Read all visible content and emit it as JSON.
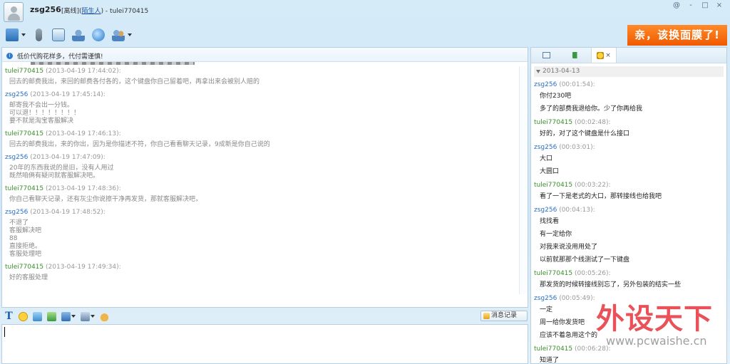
{
  "title": {
    "nickname": "zsg256",
    "status_prefix": "[离线](",
    "status_link": "陌生人",
    "status_suffix": ") - tulei770415"
  },
  "window_buttons": [
    "@",
    "-",
    "□",
    "×"
  ],
  "promo": {
    "text": "亲，该换面膜了!"
  },
  "notice": {
    "text": "低价代购花样多，代付需谨慎!"
  },
  "chat": [
    {
      "sender": "tulei770415",
      "role": "peer",
      "time": "(2013-04-19 17:44:02):",
      "lines": [
        "回去的邮费我出，来回的邮费各付各的，这个键盘你自己留着吧，再拿出来会被别人赔的"
      ]
    },
    {
      "sender": "zsg256",
      "role": "me",
      "time": "(2013-04-19 17:45:14):",
      "lines": [
        "邮寄我不会出一分钱。",
        "可以退！！！！！！！！",
        "要不就是淘宝客服解决"
      ]
    },
    {
      "sender": "tulei770415",
      "role": "peer",
      "time": "(2013-04-19 17:46:13):",
      "lines": [
        "回去的邮费我出，来的你出，因为是你描述不符，你自己看看聊天记录，9成新是你自己说的"
      ]
    },
    {
      "sender": "zsg256",
      "role": "me",
      "time": "(2013-04-19 17:47:09):",
      "lines": [
        "20年的东西我说的是旧，没有人用过",
        "既然咱俩有疑问就客服解决吧。"
      ]
    },
    {
      "sender": "tulei770415",
      "role": "peer",
      "time": "(2013-04-19 17:48:36):",
      "lines": [
        "你自己看聊天记录，还有灰尘你说擦干净再发货，那就客服解决吧，"
      ]
    },
    {
      "sender": "zsg256",
      "role": "me",
      "time": "(2013-04-19 17:48:52):",
      "lines": [
        "不退了",
        "客服解决吧",
        "88",
        "直接拒绝。",
        "客服处理吧"
      ]
    },
    {
      "sender": "tulei770415",
      "role": "peer",
      "time": "(2013-04-19 17:49:34):",
      "lines": [
        "好的客服处理"
      ]
    }
  ],
  "history_button": {
    "label": "消息记录"
  },
  "right_panel": {
    "date": "2013-04-13",
    "messages": [
      {
        "sender": "zsg256",
        "role": "me",
        "time": "(00:01:54):",
        "lines": [
          "你付230吧",
          "多了的部费我退给你。少了你再给我"
        ]
      },
      {
        "sender": "tulei770415",
        "role": "peer",
        "time": "(00:02:48):",
        "lines": [
          "好的，对了这个键盘是什么接口"
        ]
      },
      {
        "sender": "zsg256",
        "role": "me",
        "time": "(00:03:01):",
        "lines": [
          "大口",
          "大圆口"
        ]
      },
      {
        "sender": "tulei770415",
        "role": "peer",
        "time": "(00:03:22):",
        "lines": [
          "看了一下是老式的大口，那转接线也给我吧"
        ]
      },
      {
        "sender": "zsg256",
        "role": "me",
        "time": "(00:04:13):",
        "lines": [
          "找找看",
          "有一定给你",
          "对我来说没用用处了",
          "以前就那那个线测试了一下键盘"
        ]
      },
      {
        "sender": "tulei770415",
        "role": "peer",
        "time": "(00:05:26):",
        "lines": [
          "那发货的时候转接线别忘了，另外包装的结实一些"
        ]
      },
      {
        "sender": "zsg256",
        "role": "me",
        "time": "(00:05:49):",
        "lines": [
          "一定",
          "周一给你发货吧",
          "应该不着急用这个的"
        ]
      },
      {
        "sender": "tulei770415",
        "role": "peer",
        "time": "(00:06:28):",
        "lines": [
          "知道了"
        ]
      }
    ]
  },
  "watermark": {
    "text": "外设天下",
    "url": "www.pcwaishe.cn"
  },
  "colors": {
    "peer": "#3a8f2a",
    "me": "#2a6fc4",
    "promo": "#f06a10"
  }
}
